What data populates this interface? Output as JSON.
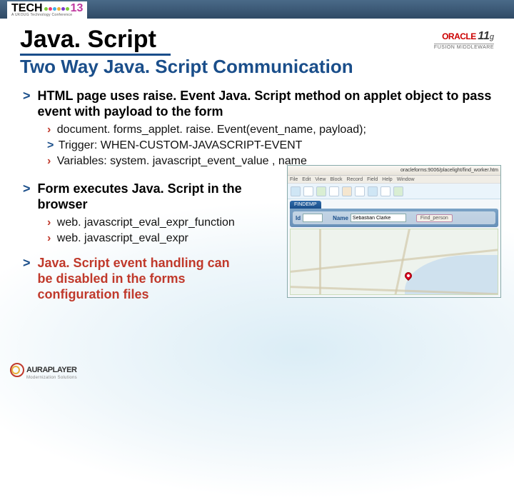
{
  "header": {
    "logo_main": "TECH",
    "logo_num": "13",
    "logo_sub": "A UKOUG Technology Conference"
  },
  "badge": {
    "oracle": "ORACLE",
    "eleven": "11",
    "g": "g",
    "fm": "FUSION MIDDLEWARE"
  },
  "title": "Java. Script",
  "subtitle": "Two Way Java. Script Communication",
  "b1": "HTML page uses raise. Event Java. Script method on applet object to pass event with payload to the form",
  "b1_s1": " document. forms_applet. raise. Event(event_name, payload);",
  "b1_s2": "Trigger: WHEN-CUSTOM-JAVASCRIPT-EVENT",
  "b1_s3": " Variables: system. javascript_event_value , name",
  "b2": "Form executes Java. Script in the browser",
  "b2_s1": " web. javascript_eval_expr_function",
  "b2_s2": " web. javascript_eval_expr",
  "b3": "Java. Script event handling can be disabled in the forms configuration files",
  "screenshot": {
    "title": " ",
    "url_hint": "oracleforms:9006/placelight/find_worker.htm",
    "menu": [
      "File",
      "Edit",
      "View",
      "Block",
      "Record",
      "Field",
      "Help",
      "Window"
    ],
    "tab": "FINDEMP",
    "label_id": "Id",
    "label_name": "Name",
    "val_name": "Sebastian Clarke",
    "btn": "Find_person"
  },
  "footer": {
    "brand": "AURAPLAYER",
    "tag": "Modernization Solutions"
  }
}
